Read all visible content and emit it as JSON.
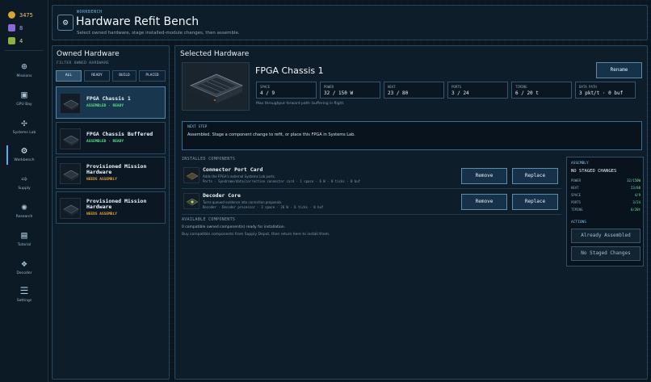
{
  "resources": [
    {
      "icon": "coin-icon",
      "value": "3475",
      "color": "#d9a43a"
    },
    {
      "icon": "crystal-icon",
      "value": "8",
      "color": "#8a6bd6"
    },
    {
      "icon": "chip-icon",
      "value": "4",
      "color": "#8fb03a"
    }
  ],
  "nav": [
    {
      "icon": "target-icon",
      "glyph": "⊕",
      "label": "Missions"
    },
    {
      "icon": "cube-icon",
      "glyph": "▣",
      "label": "GPU Bay"
    },
    {
      "icon": "network-icon",
      "glyph": "✣",
      "label": "Systems Lab"
    },
    {
      "icon": "cog-icon",
      "glyph": "⚙",
      "label": "Workbench"
    },
    {
      "icon": "arrow-icon",
      "glyph": "⇨",
      "label": "Supply"
    },
    {
      "icon": "research-icon",
      "glyph": "✺",
      "label": "Research"
    },
    {
      "icon": "book-icon",
      "glyph": "▤",
      "label": "Tutorial"
    },
    {
      "icon": "decoder-icon",
      "glyph": "❖",
      "label": "Decoder"
    },
    {
      "icon": "sliders-icon",
      "glyph": "☰",
      "label": "Settings"
    }
  ],
  "header": {
    "kicker": "WORKBENCH",
    "title": "Hardware Refit Bench",
    "subtitle": "Select owned hardware, stage installed-module changes, then assemble."
  },
  "owned": {
    "title": "Owned Hardware",
    "filter_label": "FILTER OWNED HARDWARE",
    "filters": [
      "ALL",
      "READY",
      "BUILD",
      "PLACED"
    ],
    "items": [
      {
        "name": "FPGA Chassis 1",
        "status": "ASSEMBLED · READY",
        "status_color": "#5fdc8a"
      },
      {
        "name": "FPGA Chassis Buffered",
        "status": "ASSEMBLED · READY",
        "status_color": "#5fdc8a"
      },
      {
        "name": "Provisioned Mission Hardware",
        "status": "NEEDS ASSEMBLY",
        "status_color": "#e0a038"
      },
      {
        "name": "Provisioned Mission Hardware",
        "status": "NEEDS ASSEMBLY",
        "status_color": "#e0a038"
      }
    ]
  },
  "selected": {
    "section_title": "Selected Hardware",
    "name": "FPGA Chassis 1",
    "rename_label": "Rename",
    "stats": [
      {
        "k": "SPACE",
        "v": "4 / 9"
      },
      {
        "k": "POWER",
        "v": "32 / 150 W"
      },
      {
        "k": "HEAT",
        "v": "23 / 80"
      },
      {
        "k": "PORTS",
        "v": "3 / 24"
      },
      {
        "k": "TIMING",
        "v": "6 / 20 t"
      },
      {
        "k": "DATA PATH",
        "v": "3 pkt/t · 0 buf"
      }
    ],
    "note": "Max throughput forward path: buffering in flight.",
    "next_step_label": "NEXT STEP",
    "next_step_text": "Assembled. Stage a component change to refit, or place this FPGA in Systems Lab."
  },
  "installed": {
    "label": "INSTALLED COMPONENTS",
    "remove_label": "Remove",
    "replace_label": "Replace",
    "items": [
      {
        "name": "Connector Port Card",
        "desc": "Adds the FPGA's external Systems Lab ports.",
        "spec": "Ports · Syndrome/data/correction connector card · 1 space · 6 W · 0 ticks · 0 buf"
      },
      {
        "name": "Decoder Core",
        "desc": "Turns queued evidence into correction proposals.",
        "spec": "Decoder · Decoder processor · 3 space · 26 W · 6 ticks · 0 buf"
      }
    ]
  },
  "available": {
    "label": "AVAILABLE COMPONENTS",
    "count_text": "0 compatible owned component(s) ready for installation.",
    "hint": "Buy compatible components from Supply Depot, then return here to install them."
  },
  "assembly": {
    "label": "ASSEMBLY",
    "title": "NO STAGED CHANGES",
    "rows": [
      {
        "k": "POWER",
        "v": "32/150W"
      },
      {
        "k": "HEAT",
        "v": "23/80"
      },
      {
        "k": "SPACE",
        "v": "4/9"
      },
      {
        "k": "PORTS",
        "v": "3/24"
      },
      {
        "k": "TIMING",
        "v": "6/20t"
      }
    ],
    "actions_label": "ACTIONS",
    "btn_assembled": "Already Assembled",
    "btn_nochanges": "No Staged Changes"
  }
}
